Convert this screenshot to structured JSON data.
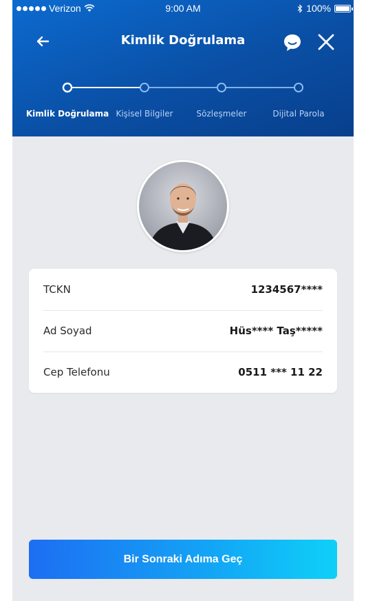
{
  "status_bar": {
    "carrier": "Verizon",
    "time": "9:00 AM",
    "battery": "100%"
  },
  "nav": {
    "title": "Kimlik Doğrulama",
    "back_icon": "arrow-left-icon",
    "chat_icon": "chat-bubble-icon",
    "close_icon": "close-icon"
  },
  "stepper": {
    "steps": [
      {
        "label": "Kimlik Doğrulama",
        "active": true
      },
      {
        "label": "Kişisel Bilgiler",
        "active": false
      },
      {
        "label": "Sözleşmeler",
        "active": false
      },
      {
        "label": "Dijital Parola",
        "active": false
      }
    ]
  },
  "profile": {
    "fields": [
      {
        "label": "TCKN",
        "value": "1234567****"
      },
      {
        "label": "Ad Soyad",
        "value": "Hüs**** Taş*****"
      },
      {
        "label": "Cep Telefonu",
        "value": "0511 *** 11 22"
      }
    ]
  },
  "cta": {
    "label": "Bir Sonraki Adıma Geç"
  },
  "colors": {
    "header_start": "#0c6bd0",
    "header_end": "#083f8c",
    "background": "#e9eaee",
    "cta_start": "#1d6ef2",
    "cta_end": "#0fd0f8"
  }
}
